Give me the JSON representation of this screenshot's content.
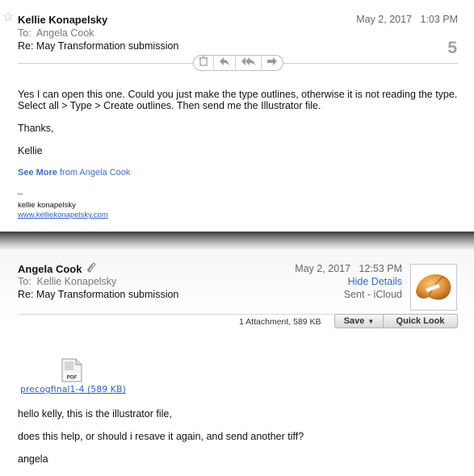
{
  "message1": {
    "sender": "Kellie Konapelsky",
    "to_label": "To:",
    "to_name": "Angela Cook",
    "subject": "Re: May Transformation submission",
    "date": "May 2, 2017",
    "time": "1:03 PM",
    "count": "5",
    "body": [
      "Yes I can open this one. Could you just make the type outlines, otherwise it is not reading the type.",
      "Select all > Type > Create outlines. Then send me the Illustrator file.",
      "Thanks,",
      "Kellie"
    ],
    "see_more_bold": "See More",
    "see_more_rest": " from Angela Cook",
    "signature": {
      "dashes": "--",
      "name": "kellie konapelsky",
      "link": "www.kelliekonapelsky.com"
    }
  },
  "message2": {
    "sender": "Angela Cook",
    "to_label": "To:",
    "to_name": "Kellie Konapelsky",
    "subject": "Re: May Transformation submission",
    "date": "May 2, 2017",
    "time": "12:53 PM",
    "hide_details": "Hide Details",
    "sent": "Sent - iCloud",
    "attachment_count": "1 Attachment, 589 KB",
    "save_label": "Save",
    "quick_look_label": "Quick Look",
    "attachment_name": "precogfinal1-4 (589 KB)",
    "pdf_label": "PDF",
    "body": [
      "hello kelly, this is the illustrator file,",
      "does this help, or should i resave it again, and send another tiff?",
      "angela"
    ]
  },
  "icons": [
    "star-icon",
    "trash-icon",
    "reply-icon",
    "reply-all-icon",
    "forward-icon",
    "paperclip-icon",
    "chevron-down-icon",
    "pdf-file-icon",
    "fortune-cookie-avatar"
  ],
  "colors": {
    "link": "#2b62c8",
    "hide_details": "#2f6ad0",
    "muted": "#777777"
  }
}
